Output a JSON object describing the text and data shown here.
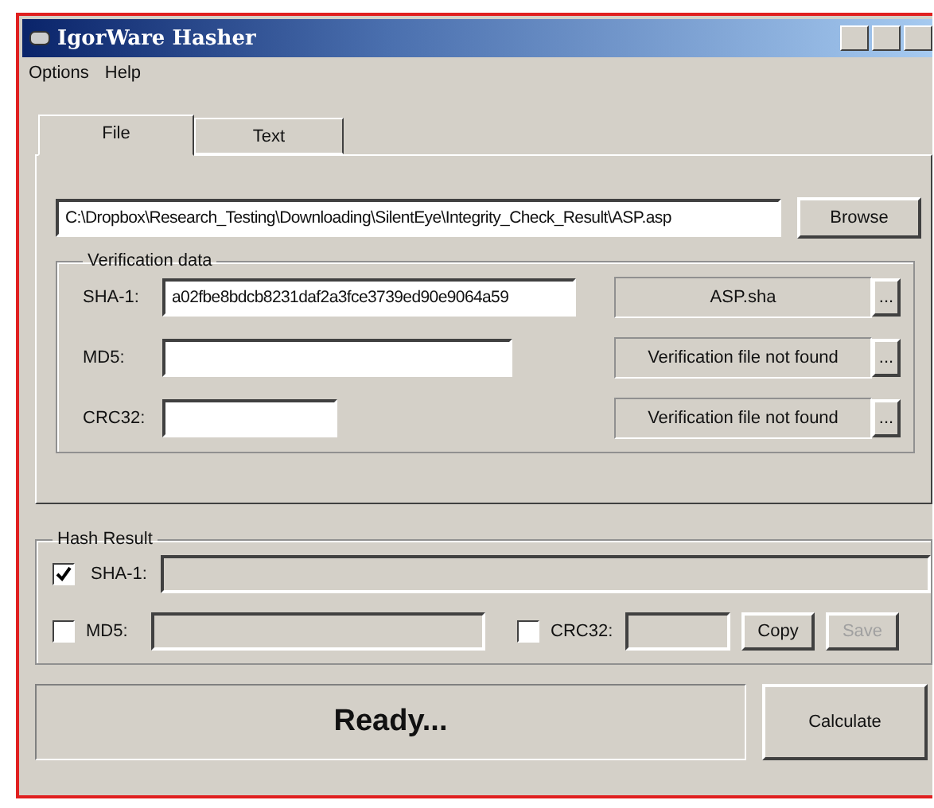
{
  "window": {
    "title": "IgorWare Hasher"
  },
  "menu": [
    "Options",
    "Help"
  ],
  "tabs": [
    {
      "label": "File",
      "selected": true
    },
    {
      "label": "Text",
      "selected": false
    }
  ],
  "file": {
    "path": "C:\\Dropbox\\Research_Testing\\Downloading\\SilentEye\\Integrity_Check_Result\\ASP.asp",
    "browse": "Browse"
  },
  "verification": {
    "title": "Verification data",
    "rows": [
      {
        "label": "SHA-1:",
        "value": "a02fbe8bdcb8231daf2a3fce3739ed90e9064a59",
        "file": "ASP.sha",
        "button": "..."
      },
      {
        "label": "MD5:",
        "file": "Verification file not found",
        "button": "..."
      },
      {
        "label": "CRC32:",
        "file": "Verification file not found",
        "button": "..."
      }
    ]
  },
  "hash_result": {
    "title": "Hash Result",
    "sha1": {
      "label": "SHA-1:",
      "checked": true
    },
    "md5": {
      "label": "MD5:",
      "checked": false
    },
    "crc32": {
      "label": "CRC32:",
      "checked": false
    },
    "buttons": [
      {
        "label": "Copy",
        "disabled": false
      },
      {
        "label": "Save",
        "disabled": true
      }
    ]
  },
  "status": "Ready...",
  "calculate": "Calculate"
}
